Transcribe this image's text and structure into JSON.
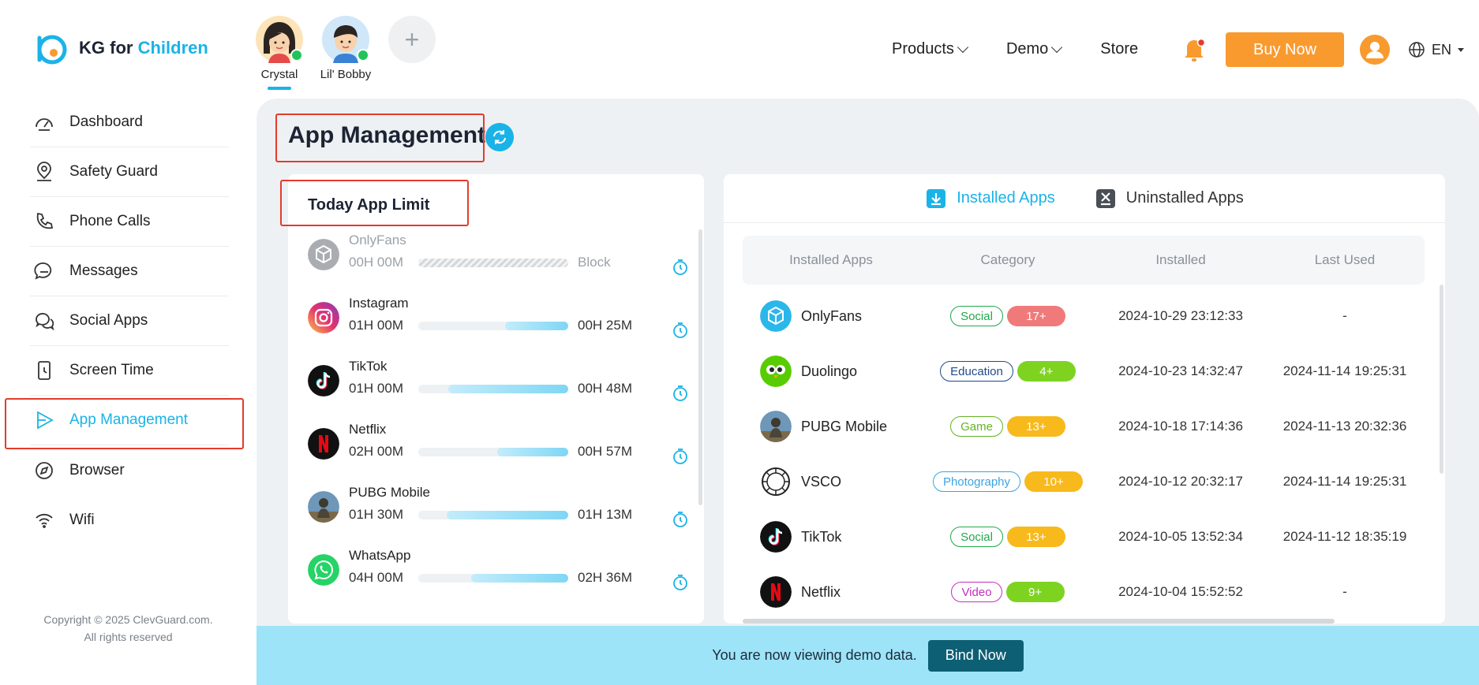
{
  "brand": {
    "name_prefix": "KG for",
    "name_accent": "Children"
  },
  "sidebar": {
    "items": [
      {
        "label": "Dashboard",
        "icon": "dashboard-icon"
      },
      {
        "label": "Safety Guard",
        "icon": "location-pin-icon"
      },
      {
        "label": "Phone Calls",
        "icon": "phone-icon"
      },
      {
        "label": "Messages",
        "icon": "message-icon"
      },
      {
        "label": "Social Apps",
        "icon": "chat-bubbles-icon"
      },
      {
        "label": "Screen Time",
        "icon": "clock-phone-icon"
      },
      {
        "label": "App Management",
        "icon": "play-icon"
      },
      {
        "label": "Browser",
        "icon": "compass-icon"
      },
      {
        "label": "Wifi",
        "icon": "wifi-icon"
      }
    ],
    "active": "App Management",
    "copyright_line1": "Copyright © 2025 ClevGuard.com.",
    "copyright_line2": "All rights reserved"
  },
  "children": [
    {
      "name": "Crystal",
      "selected": true
    },
    {
      "name": "Lil' Bobby",
      "selected": false
    }
  ],
  "topnav": {
    "products": "Products",
    "demo": "Demo",
    "store": "Store",
    "buy_now": "Buy Now",
    "language": "EN",
    "accent_color": "#f99a2f"
  },
  "page": {
    "title": "App Management"
  },
  "limits": {
    "title": "Today App Limit",
    "rows": [
      {
        "name": "OnlyFans",
        "limit": "00H 00M",
        "used": "Block",
        "fraction": 0,
        "blocked": true
      },
      {
        "name": "Instagram",
        "limit": "01H 00M",
        "used": "00H 25M",
        "fraction": 0.42,
        "blocked": false
      },
      {
        "name": "TikTok",
        "limit": "01H 00M",
        "used": "00H 48M",
        "fraction": 0.8,
        "blocked": false
      },
      {
        "name": "Netflix",
        "limit": "02H 00M",
        "used": "00H 57M",
        "fraction": 0.475,
        "blocked": false
      },
      {
        "name": "PUBG Mobile",
        "limit": "01H 30M",
        "used": "01H 13M",
        "fraction": 0.81,
        "blocked": false
      },
      {
        "name": "WhatsApp",
        "limit": "04H 00M",
        "used": "02H 36M",
        "fraction": 0.65,
        "blocked": false
      }
    ]
  },
  "apps": {
    "tab_installed": "Installed Apps",
    "tab_uninstalled": "Uninstalled Apps",
    "headers": {
      "name": "Installed Apps",
      "category": "Category",
      "installed": "Installed",
      "last_used": "Last Used"
    },
    "rows": [
      {
        "name": "OnlyFans",
        "category": "Social",
        "cat_color": "#21a84a",
        "age": "17+",
        "age_color": "#f07a7a",
        "installed": "2024-10-29 23:12:33",
        "last_used": "-"
      },
      {
        "name": "Duolingo",
        "category": "Education",
        "cat_color": "#1f4a8a",
        "age": "4+",
        "age_color": "#7ed321",
        "installed": "2024-10-23 14:32:47",
        "last_used": "2024-11-14 19:25:31"
      },
      {
        "name": "PUBG Mobile",
        "category": "Game",
        "cat_color": "#63b324",
        "age": "13+",
        "age_color": "#f8b91c",
        "installed": "2024-10-18 17:14:36",
        "last_used": "2024-11-13 20:32:36"
      },
      {
        "name": "VSCO",
        "category": "Photography",
        "cat_color": "#3ba4e4",
        "age": "10+",
        "age_color": "#f8b91c",
        "installed": "2024-10-12 20:32:17",
        "last_used": "2024-11-14 19:25:31"
      },
      {
        "name": "TikTok",
        "category": "Social",
        "cat_color": "#21a84a",
        "age": "13+",
        "age_color": "#f8b91c",
        "installed": "2024-10-05 13:52:34",
        "last_used": "2024-11-12 18:35:19"
      },
      {
        "name": "Netflix",
        "category": "Video",
        "cat_color": "#c42fc0",
        "age": "9+",
        "age_color": "#7ed321",
        "installed": "2024-10-04 15:52:52",
        "last_used": "-"
      }
    ]
  },
  "demo_bar": {
    "text": "You are now viewing demo data.",
    "button": "Bind Now"
  }
}
